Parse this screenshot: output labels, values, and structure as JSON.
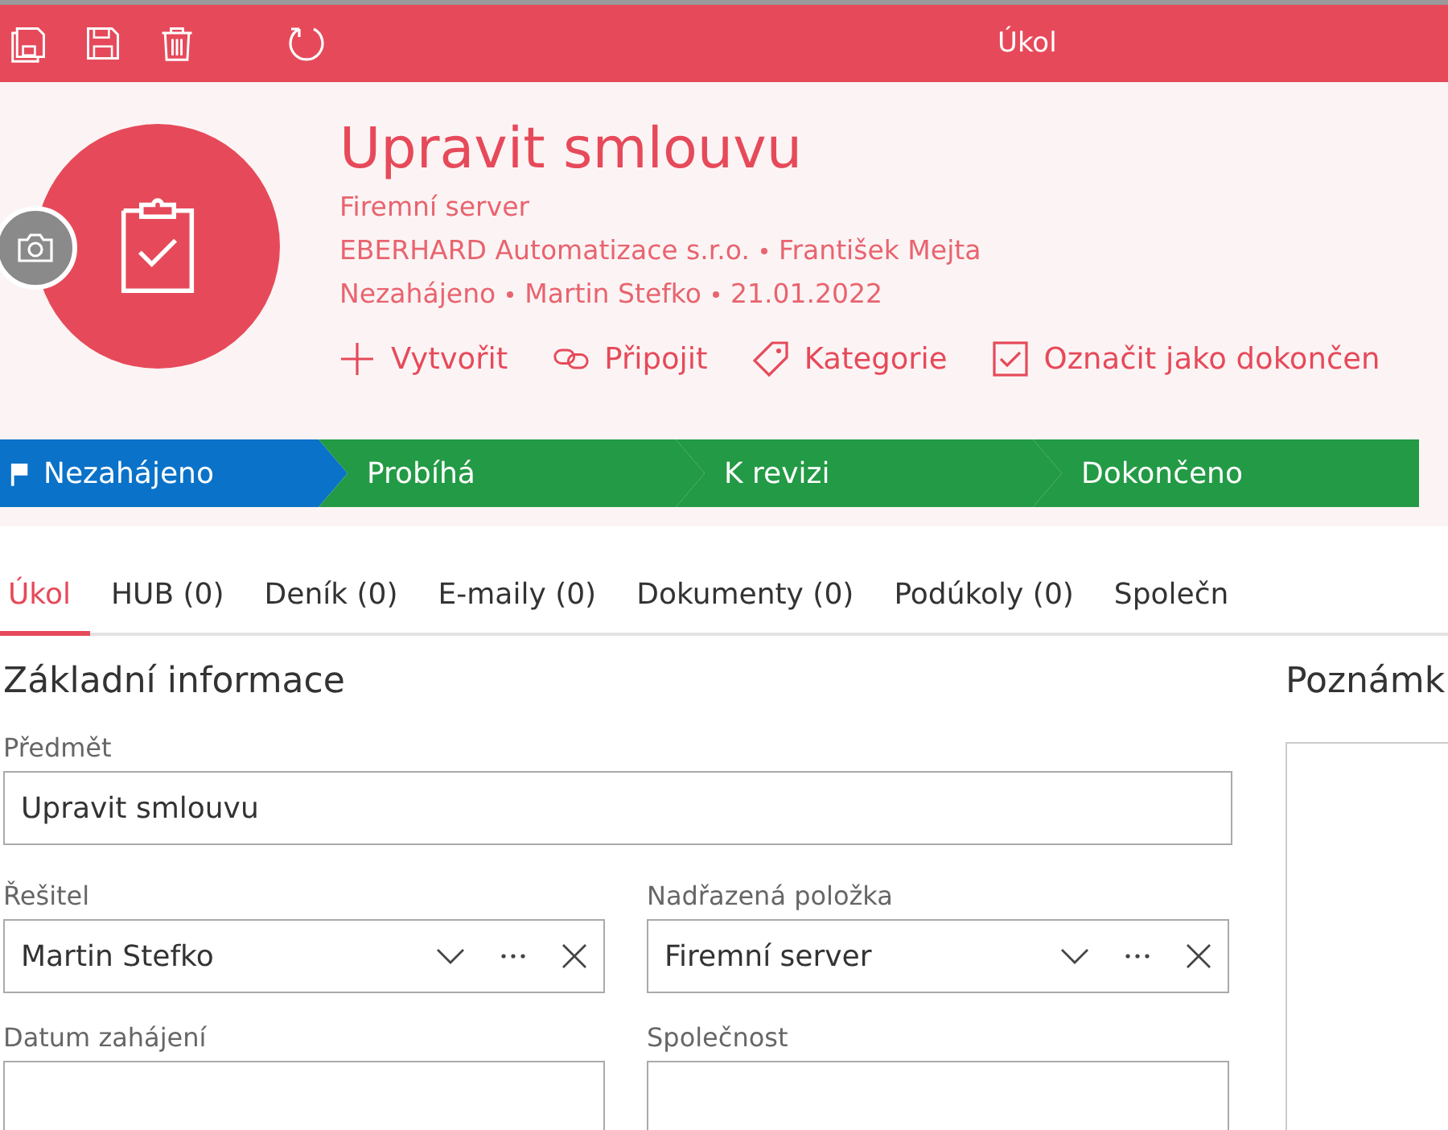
{
  "toolbar": {
    "title": "Úkol"
  },
  "header": {
    "title": "Upravit smlouvu",
    "lines": [
      [
        "Firemní server"
      ],
      [
        "EBERHARD Automatizace s.r.o.",
        "František Mejta"
      ],
      [
        "Nezahájeno",
        "Martin Stefko",
        "21.01.2022"
      ]
    ],
    "actions": [
      {
        "kind": "plus",
        "label": "Vytvořit"
      },
      {
        "kind": "link",
        "label": "Připojit"
      },
      {
        "kind": "tag",
        "label": "Kategorie"
      },
      {
        "kind": "check",
        "label": "Označit jako dokončen"
      }
    ]
  },
  "stages": [
    {
      "label": "Nezahájeno",
      "selected": true
    },
    {
      "label": "Probíhá",
      "selected": false
    },
    {
      "label": "K revizi",
      "selected": false
    },
    {
      "label": "Dokončeno",
      "selected": false
    }
  ],
  "tabs": [
    {
      "label": "Úkol",
      "selected": true
    },
    {
      "label": "HUB (0)",
      "selected": false
    },
    {
      "label": "Deník (0)",
      "selected": false
    },
    {
      "label": "E-maily (0)",
      "selected": false
    },
    {
      "label": "Dokumenty (0)",
      "selected": false
    },
    {
      "label": "Podúkoly (0)",
      "selected": false
    },
    {
      "label": "Společn",
      "selected": false
    }
  ],
  "basic": {
    "title": "Základní informace",
    "subject": {
      "label": "Předmět",
      "value": "Upravit smlouvu"
    },
    "fields": [
      {
        "label": "Řešitel",
        "value": "Martin Stefko"
      },
      {
        "label": "Nadřazená položka",
        "value": "Firemní server"
      },
      {
        "label": "Datum zahájení"
      },
      {
        "label": "Společnost"
      }
    ]
  },
  "notes": {
    "title": "Poznámk"
  }
}
